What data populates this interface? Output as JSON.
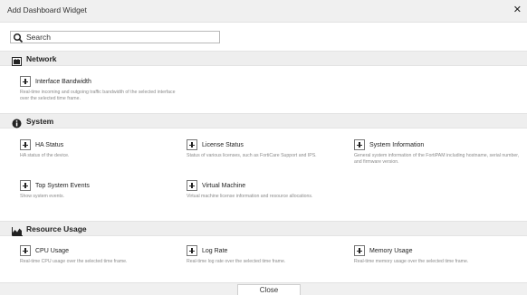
{
  "dialog": {
    "title": "Add Dashboard Widget",
    "close_glyph": "✕"
  },
  "search": {
    "placeholder": "Search"
  },
  "sections": {
    "network": {
      "label": "Network",
      "icon": "network-icon",
      "widgets": [
        {
          "name": "Interface Bandwidth",
          "description": "Real-time incoming and outgoing traffic bandwidth of the selected interface over the selected time frame."
        }
      ]
    },
    "system": {
      "label": "System",
      "icon": "info-icon",
      "widgets": [
        {
          "name": "HA Status",
          "description": "HA status of the device."
        },
        {
          "name": "License Status",
          "description": "Status of various licenses, such as FortiCare Support and IPS."
        },
        {
          "name": "System Information",
          "description": "General system information of the FortiPAM including hostname, serial number, and firmware version."
        },
        {
          "name": "Top System Events",
          "description": "Show system events."
        },
        {
          "name": "Virtual Machine",
          "description": "Virtual machine license information and resource allocations."
        }
      ]
    },
    "resource": {
      "label": "Resource Usage",
      "icon": "area-chart-icon",
      "widgets": [
        {
          "name": "CPU Usage",
          "description": "Real-time CPU usage over the selected time frame."
        },
        {
          "name": "Log Rate",
          "description": "Real-time log rate over the selected time frame."
        },
        {
          "name": "Memory Usage",
          "description": "Real-time memory usage over the selected time frame."
        }
      ]
    }
  },
  "footer": {
    "close_label": "Close"
  }
}
